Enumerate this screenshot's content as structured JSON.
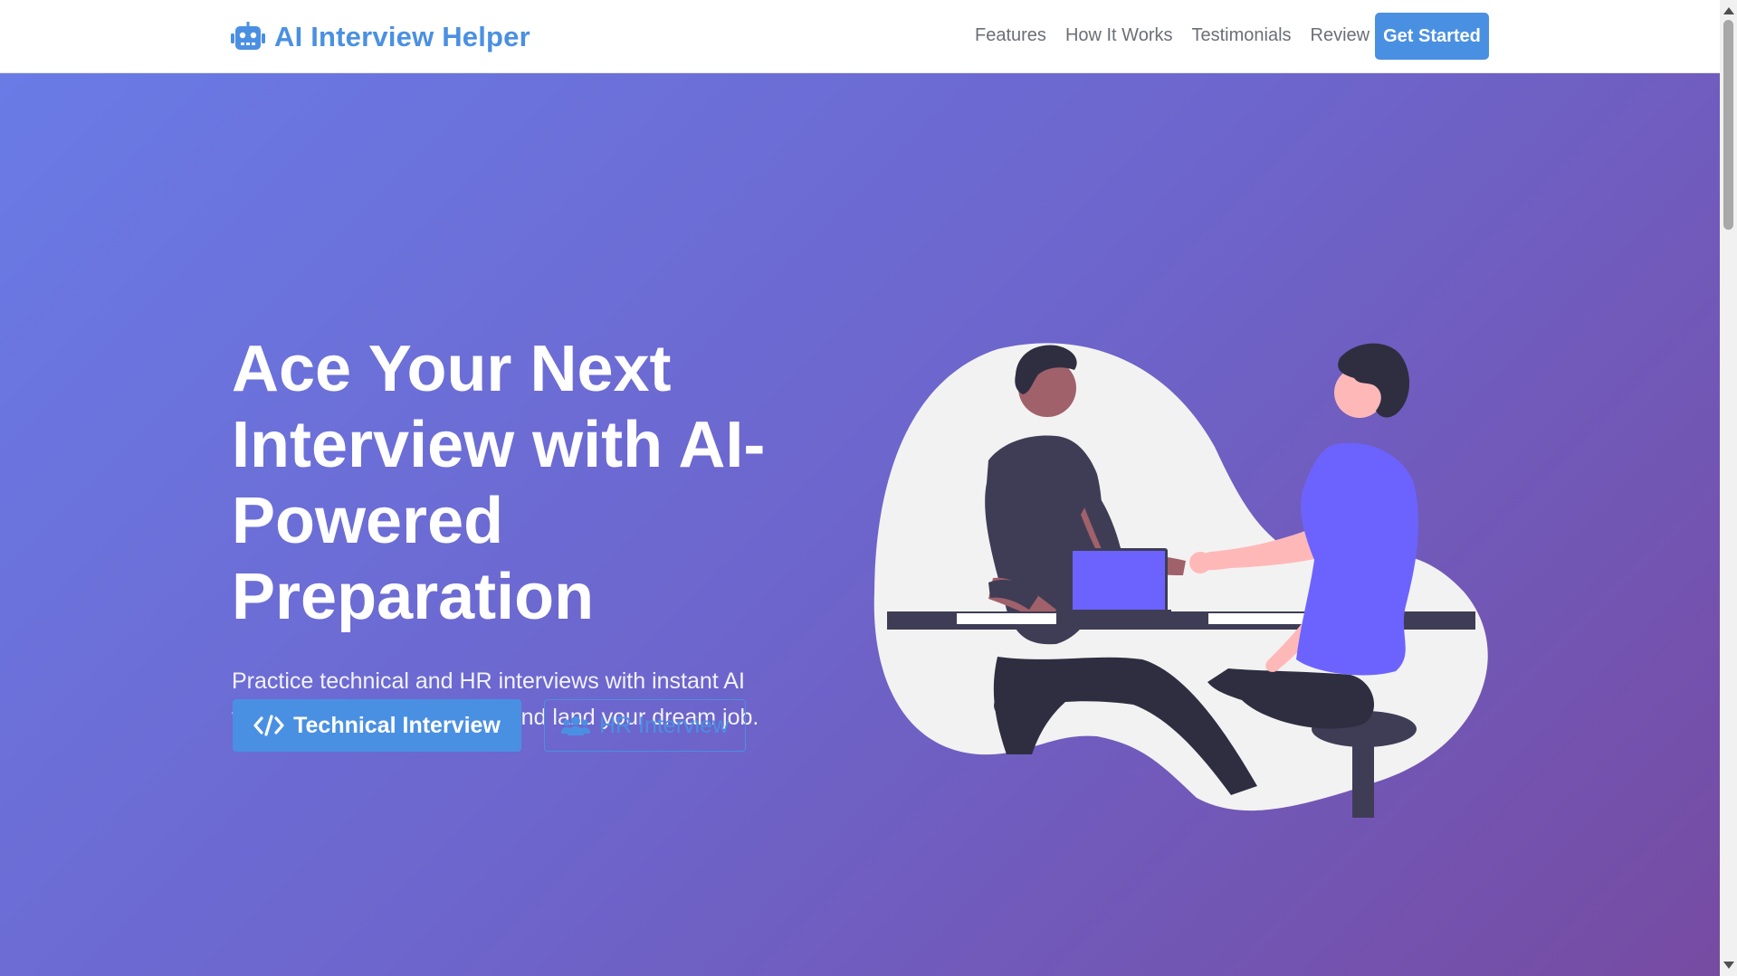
{
  "navbar": {
    "brand_icon": "robot-icon",
    "brand_name": "AI Interview Helper",
    "links": [
      "Features",
      "How It Works",
      "Testimonials",
      "Review"
    ],
    "cta_label": "Get Started"
  },
  "hero": {
    "title": "Ace Your Next Interview with AI-Powered Preparation",
    "subtitle": "Practice technical and HR interviews with instant AI feedback. Build confidence and land your dream job.",
    "buttons": [
      {
        "label": "Technical Interview",
        "icon": "code-icon"
      },
      {
        "label": "HR Interview",
        "icon": "users-icon"
      }
    ],
    "illustration": "handshake-interview-illustration"
  },
  "colors": {
    "accent": "#4a90e2",
    "hero_gradient_start": "#6a7be6",
    "hero_gradient_end": "#764ba2",
    "illustration_purple": "#6c63ff",
    "illustration_dark": "#3f3d56",
    "illustration_skin_dark": "#a0616a",
    "illustration_skin_light": "#ffb8b8"
  }
}
